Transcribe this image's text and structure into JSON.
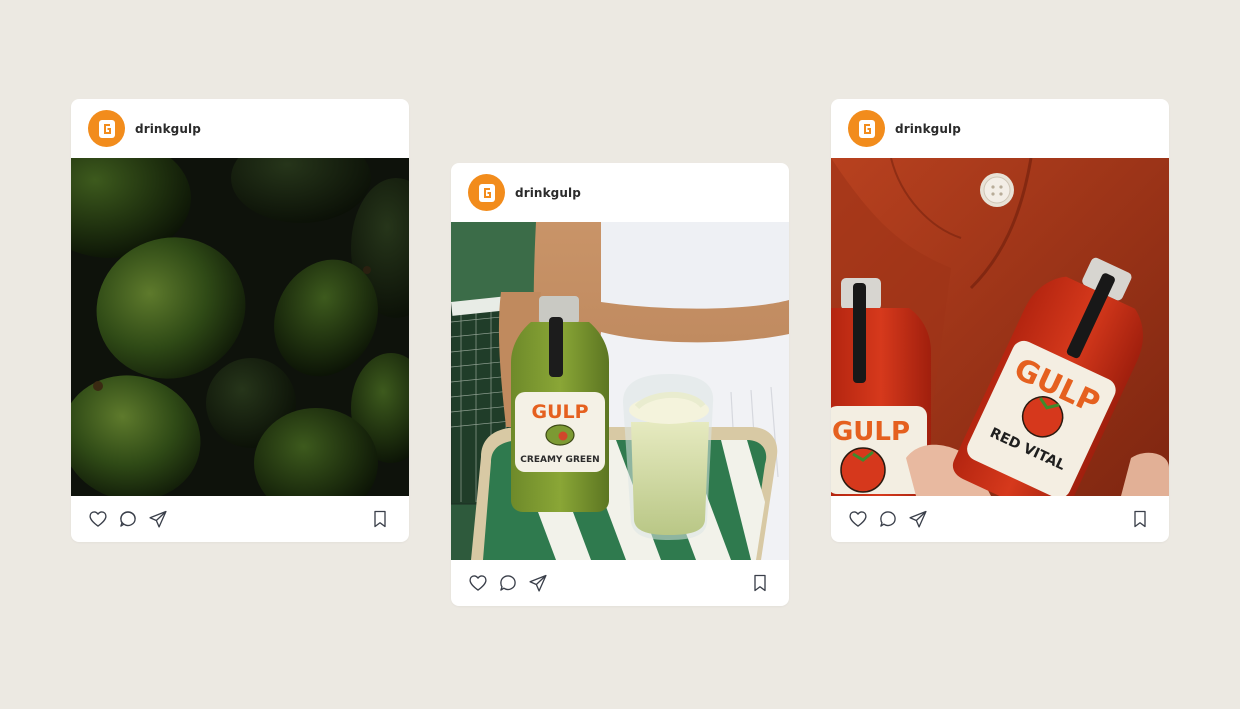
{
  "posts": [
    {
      "username": "drinkgulp",
      "avatar_icon": "gulp-logo-icon",
      "photo": "avocado-photo",
      "actions": [
        "heart-icon",
        "comment-icon",
        "share-icon",
        "bookmark-icon"
      ]
    },
    {
      "username": "drinkgulp",
      "avatar_icon": "gulp-logo-icon",
      "photo": "creamy-green-bottle-photo",
      "label_brand": "GULP",
      "label_flavor": "CREAMY GREEN",
      "actions": [
        "heart-icon",
        "comment-icon",
        "share-icon",
        "bookmark-icon"
      ]
    },
    {
      "username": "drinkgulp",
      "avatar_icon": "gulp-logo-icon",
      "photo": "red-vital-bottle-photo",
      "label_brand": "GULP",
      "label_flavor": "RED VITAL",
      "actions": [
        "heart-icon",
        "comment-icon",
        "share-icon",
        "bookmark-icon"
      ]
    }
  ],
  "colors": {
    "background": "#ece9e2",
    "brand_orange": "#f28c1c",
    "card": "#ffffff",
    "icon_stroke": "#3a3f4a"
  }
}
